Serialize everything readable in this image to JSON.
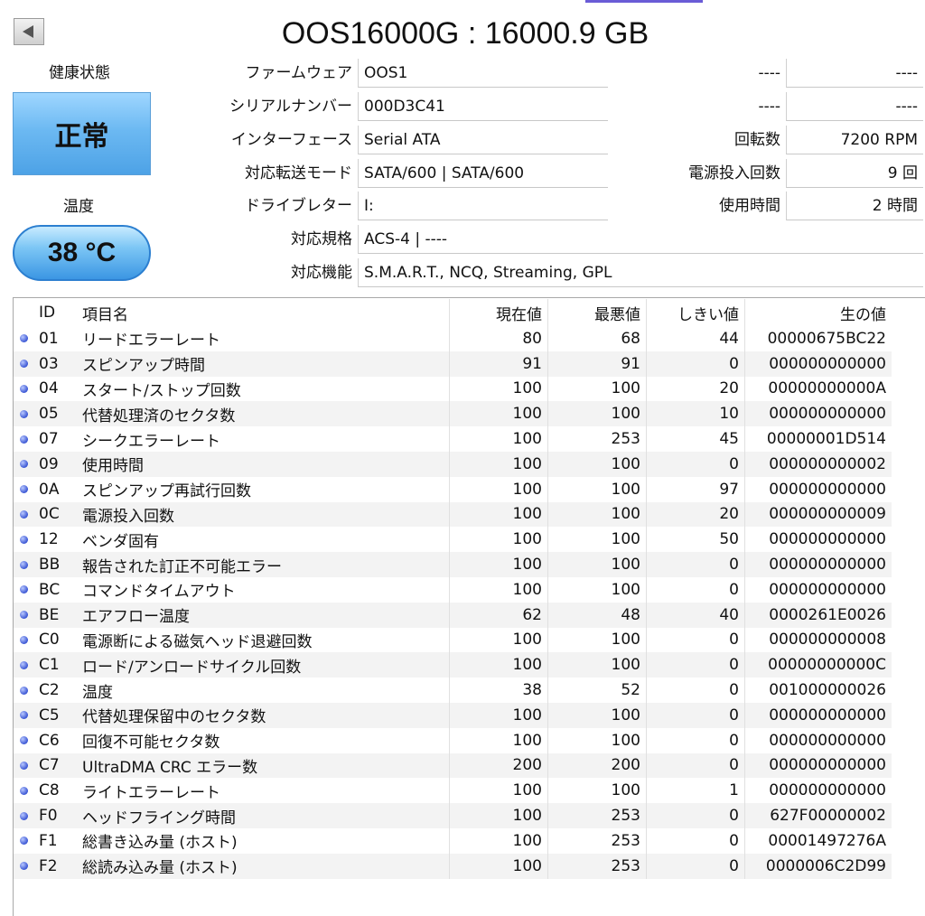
{
  "title": "OOS16000G : 16000.9 GB",
  "health": {
    "label": "健康状態",
    "status": "正常"
  },
  "temperature": {
    "label": "温度",
    "value": "38 °C"
  },
  "info_left": [
    {
      "label": "ファームウェア",
      "value": "OOS1"
    },
    {
      "label": "シリアルナンバー",
      "value": "000D3C41"
    },
    {
      "label": "インターフェース",
      "value": "Serial ATA"
    },
    {
      "label": "対応転送モード",
      "value": "SATA/600 | SATA/600"
    },
    {
      "label": "ドライブレター",
      "value": "I:"
    },
    {
      "label": "対応規格",
      "value": "ACS-4 | ----"
    },
    {
      "label": "対応機能",
      "value": "S.M.A.R.T., NCQ, Streaming, GPL"
    }
  ],
  "info_right": [
    {
      "label": "----",
      "value": "----"
    },
    {
      "label": "----",
      "value": "----"
    },
    {
      "label": "回転数",
      "value": "7200 RPM"
    },
    {
      "label": "電源投入回数",
      "value": "9 回"
    },
    {
      "label": "使用時間",
      "value": "2 時間"
    }
  ],
  "table": {
    "headers": {
      "id": "ID",
      "name": "項目名",
      "current": "現在値",
      "worst": "最悪値",
      "threshold": "しきい値",
      "raw": "生の値"
    },
    "rows": [
      [
        "01",
        "リードエラーレート",
        "80",
        "68",
        "44",
        "00000675BC22"
      ],
      [
        "03",
        "スピンアップ時間",
        "91",
        "91",
        "0",
        "000000000000"
      ],
      [
        "04",
        "スタート/ストップ回数",
        "100",
        "100",
        "20",
        "00000000000A"
      ],
      [
        "05",
        "代替処理済のセクタ数",
        "100",
        "100",
        "10",
        "000000000000"
      ],
      [
        "07",
        "シークエラーレート",
        "100",
        "253",
        "45",
        "00000001D514"
      ],
      [
        "09",
        "使用時間",
        "100",
        "100",
        "0",
        "000000000002"
      ],
      [
        "0A",
        "スピンアップ再試行回数",
        "100",
        "100",
        "97",
        "000000000000"
      ],
      [
        "0C",
        "電源投入回数",
        "100",
        "100",
        "20",
        "000000000009"
      ],
      [
        "12",
        "ベンダ固有",
        "100",
        "100",
        "50",
        "000000000000"
      ],
      [
        "BB",
        "報告された訂正不可能エラー",
        "100",
        "100",
        "0",
        "000000000000"
      ],
      [
        "BC",
        "コマンドタイムアウト",
        "100",
        "100",
        "0",
        "000000000000"
      ],
      [
        "BE",
        "エアフロー温度",
        "62",
        "48",
        "40",
        "0000261E0026"
      ],
      [
        "C0",
        "電源断による磁気ヘッド退避回数",
        "100",
        "100",
        "0",
        "000000000008"
      ],
      [
        "C1",
        "ロード/アンロードサイクル回数",
        "100",
        "100",
        "0",
        "00000000000C"
      ],
      [
        "C2",
        "温度",
        "38",
        "52",
        "0",
        "001000000026"
      ],
      [
        "C5",
        "代替処理保留中のセクタ数",
        "100",
        "100",
        "0",
        "000000000000"
      ],
      [
        "C6",
        "回復不可能セクタ数",
        "100",
        "100",
        "0",
        "000000000000"
      ],
      [
        "C7",
        "UltraDMA CRC エラー数",
        "200",
        "200",
        "0",
        "000000000000"
      ],
      [
        "C8",
        "ライトエラーレート",
        "100",
        "100",
        "1",
        "000000000000"
      ],
      [
        "F0",
        "ヘッドフライング時間",
        "100",
        "253",
        "0",
        "627F00000002"
      ],
      [
        "F1",
        "総書き込み量 (ホスト)",
        "100",
        "253",
        "0",
        "00001497276A"
      ],
      [
        "F2",
        "総読み込み量 (ホスト)",
        "100",
        "253",
        "0",
        "0000006C2D99"
      ]
    ]
  }
}
